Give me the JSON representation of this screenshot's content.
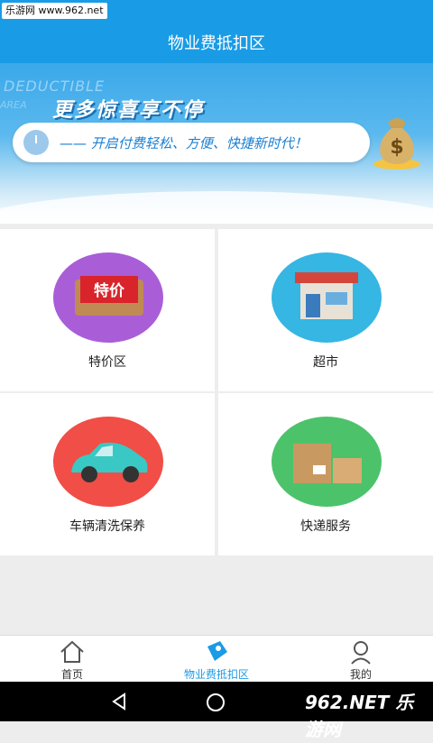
{
  "statusbar": {
    "watermark": "乐游网 www.962.net"
  },
  "header": {
    "title": "物业费抵扣区"
  },
  "banner": {
    "bg_text": "DEDUCTIBLE",
    "bg_text2": "AREA",
    "slogan": "更多惊喜享不停",
    "subtitle": "—— 开启付费轻松、方便、快捷新时代！",
    "icon": "money-bag-icon"
  },
  "grid": {
    "items": [
      {
        "label": "特价区",
        "icon": "special-offer-icon",
        "icon_text": "特价",
        "color": "#a95ed8"
      },
      {
        "label": "超市",
        "icon": "store-icon",
        "color": "#35b6e3"
      },
      {
        "label": "车辆清洗保养",
        "icon": "car-icon",
        "color": "#f04e46"
      },
      {
        "label": "快递服务",
        "icon": "package-icon",
        "color": "#4cc36a"
      }
    ]
  },
  "tabbar": {
    "items": [
      {
        "label": "首页",
        "icon": "home-icon",
        "active": false
      },
      {
        "label": "物业费抵扣区",
        "icon": "coupon-icon",
        "active": true
      },
      {
        "label": "我的",
        "icon": "user-icon",
        "active": false
      }
    ]
  },
  "system_nav": {
    "watermark": "962.NET 乐游网",
    "buttons": [
      "back-icon",
      "home-circle-icon",
      "recents-icon"
    ]
  },
  "colors": {
    "primary": "#1a9be5",
    "background": "#ededed"
  }
}
